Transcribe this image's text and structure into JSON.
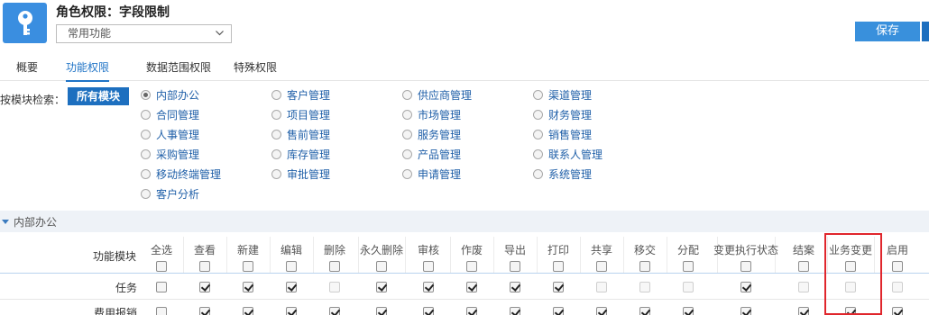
{
  "header": {
    "title": "角色权限：字段限制",
    "dropdown_value": "常用功能",
    "save_label": "保存"
  },
  "tabs": [
    "概要",
    "功能权限",
    "数据范围权限",
    "特殊权限"
  ],
  "active_tab": "功能权限",
  "module_filter": {
    "label": "按模块检索：",
    "all_label": "所有模块",
    "selected": "内部办公",
    "columns": [
      [
        "内部办公",
        "合同管理",
        "人事管理",
        "采购管理",
        "移动终端管理",
        "客户分析"
      ],
      [
        "客户管理",
        "项目管理",
        "售前管理",
        "库存管理",
        "审批管理"
      ],
      [
        "供应商管理",
        "市场管理",
        "服务管理",
        "产品管理",
        "申请管理"
      ],
      [
        "渠道管理",
        "财务管理",
        "销售管理",
        "联系人管理",
        "系统管理"
      ]
    ]
  },
  "section": {
    "label": "内部办公"
  },
  "table": {
    "module_header": "功能模块",
    "columns": [
      "全选",
      "查看",
      "新建",
      "编辑",
      "删除",
      "永久删除",
      "审核",
      "作废",
      "导出",
      "打印",
      "共享",
      "移交",
      "分配",
      "变更执行状态",
      "结案",
      "业务变更",
      "启用"
    ],
    "rows": [
      {
        "label": "任务",
        "state": [
          "u",
          "c",
          "c",
          "c",
          "d",
          "c",
          "c",
          "c",
          "c",
          "c",
          "d",
          "d",
          "d",
          "c",
          "d",
          "d",
          "d"
        ]
      },
      {
        "label": "费用报销",
        "state": [
          "u",
          "c",
          "c",
          "c",
          "c",
          "c",
          "c",
          "c",
          "c",
          "c",
          "c",
          "c",
          "c",
          "c",
          "c",
          "c",
          "c"
        ]
      }
    ]
  },
  "colors": {
    "accent": "#1d6fbf",
    "link": "#1f5fa8",
    "highlight": "#e0262c"
  }
}
